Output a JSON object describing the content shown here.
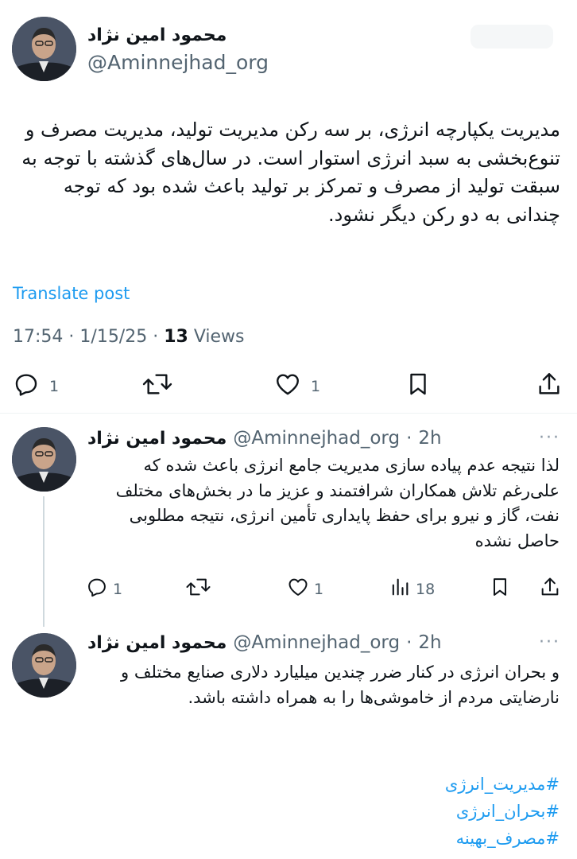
{
  "main_post": {
    "author_name": "محمود امین نژاد",
    "author_handle": "@Aminnejhad_org",
    "text": "مدیریت یکپارچه انرژی، بر سه رکن مدیریت تولید، مدیریت مصرف  و تنوع‌بخشی به سبد انرژی استوار است. در سال‌های گذشته با توجه به سبقت تولید از مصرف و تمرکز بر تولید باعث شده بود که توجه چندانی به دو رکن دیگر نشود.",
    "translate_label": "Translate post",
    "time": "17:54",
    "date": "1/15/25",
    "views_count": "13",
    "views_label": "Views",
    "reply_count": "1",
    "like_count": "1"
  },
  "replies": [
    {
      "author_name": "محمود امین نژاد",
      "author_handle": "@Aminnejhad_org",
      "sep": "·",
      "time": "2h",
      "text": "لذا نتیجه عدم پیاده سازی مدیریت جامع انرژی باعث شده که علی‌رغم تلاش همکاران شرافتمند و عزیز ما در بخش‌های مختلف نفت، گاز و نیرو برای حفظ پایداری تأمین انرژی، نتیجه مطلوبی حاصل نشده",
      "reply_count": "1",
      "like_count": "1",
      "views_count": "18"
    },
    {
      "author_name": "محمود امین نژاد",
      "author_handle": "@Aminnejhad_org",
      "sep": "·",
      "time": "2h",
      "text": "و بحران انرژی در کنار ضرر چندین میلیارد دلاری صنایع مختلف و نارضایتی مردم از خاموشی‌ها را به همراه داشته باشد.",
      "hashtags": [
        "#مدیریت_انرژی",
        "#بحران_انرژی",
        "#مصرف_بهینه"
      ]
    }
  ],
  "icons": {
    "reply": "reply-icon",
    "repost": "repost-icon",
    "like": "like-icon",
    "views": "views-icon",
    "bookmark": "bookmark-icon",
    "share": "share-icon",
    "more": "more-icon"
  },
  "colors": {
    "accent": "#1d9bf0",
    "secondary_text": "#536471",
    "primary_text": "#0f1419"
  }
}
